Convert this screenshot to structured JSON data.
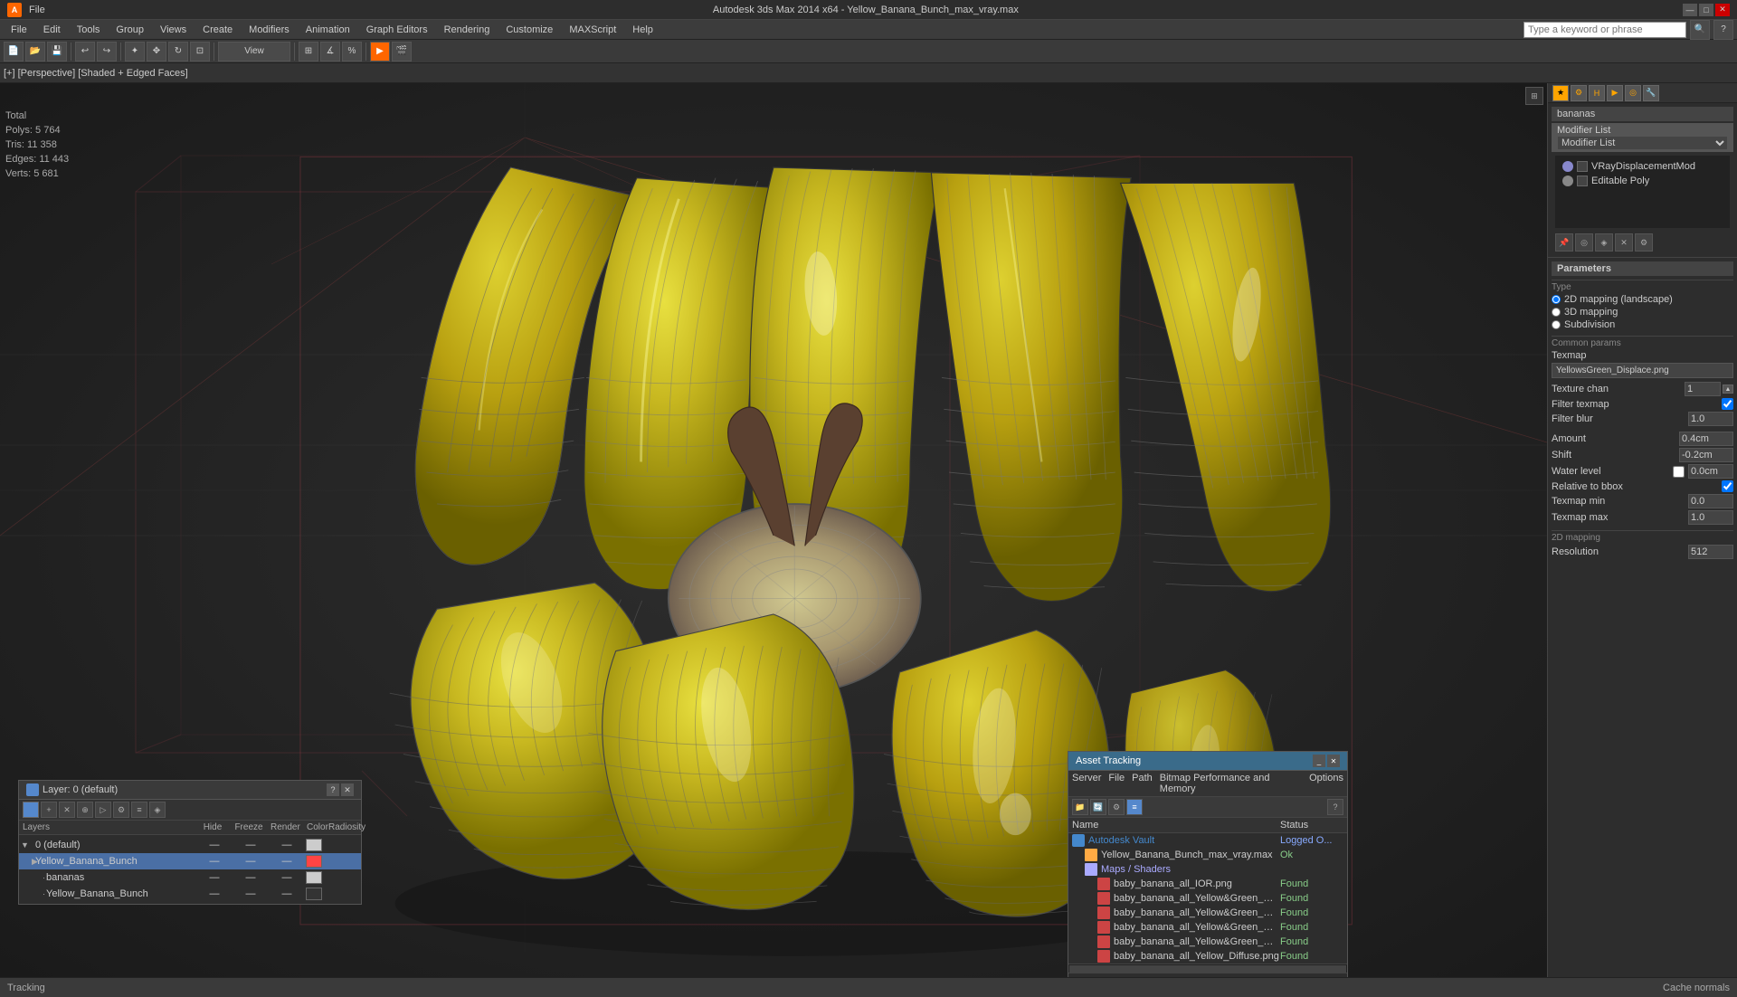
{
  "titlebar": {
    "title": "Autodesk 3ds Max 2014 x64 - Yellow_Banana_Bunch_max_vray.max",
    "minimize": "—",
    "maximize": "□",
    "close": "✕"
  },
  "menubar": {
    "items": [
      "File",
      "Edit",
      "Tools",
      "Group",
      "Views",
      "Create",
      "Modifiers",
      "Animation",
      "Graph Editors",
      "Rendering",
      "Customize",
      "MAXScript",
      "Help"
    ]
  },
  "toolbar": {
    "search_placeholder": "Type a keyword or phrase"
  },
  "viewport": {
    "label": "[+] [Perspective] [Shaded + Edged Faces]",
    "stats": {
      "polys_label": "Polys:",
      "polys_val": "5 764",
      "tris_label": "Tris:",
      "tris_val": "11 358",
      "edges_label": "Edges:",
      "edges_val": "11 443",
      "verts_label": "Verts:",
      "verts_val": "5 681"
    }
  },
  "right_panel": {
    "object_name": "bananas",
    "modifier_list_label": "Modifier List",
    "modifiers": [
      {
        "name": "VRayDisplacementMod",
        "enabled": true
      },
      {
        "name": "Editable Poly",
        "enabled": false
      }
    ],
    "params_header": "Parameters",
    "type_label": "Type",
    "type_options": [
      "2D mapping (landscape)",
      "3D mapping",
      "Subdivision"
    ],
    "type_selected": "2D mapping (landscape)",
    "common_params_label": "Common params",
    "texmap_label": "Texmap",
    "texmap_value": "YellowsGreen_Displace.png",
    "texture_chan_label": "Texture chan",
    "texture_chan_value": "1",
    "filter_texmap_label": "Filter texmap",
    "filter_texmap_checked": true,
    "filter_blur_label": "Filter blur",
    "filter_blur_value": "1.0",
    "amount_label": "Amount",
    "amount_value": "0.4cm",
    "shift_label": "Shift",
    "shift_value": "-0.2cm",
    "water_level_label": "Water level",
    "water_level_value": "0.0cm",
    "relative_bbox_label": "Relative to bbox",
    "relative_bbox_checked": true,
    "texmap_min_label": "Texmap min",
    "texmap_min_value": "0.0",
    "texmap_max_label": "Texmap max",
    "texmap_max_value": "1.0",
    "2d_mapping_label": "2D mapping",
    "resolution_label": "Resolution",
    "resolution_value": "512"
  },
  "layer_panel": {
    "title": "Layer: 0 (default)",
    "close": "✕",
    "help": "?",
    "columns": {
      "layers": "Layers",
      "hide": "Hide",
      "freeze": "Freeze",
      "render": "Render",
      "color": "Color",
      "radiosity": "Radiosity"
    },
    "rows": [
      {
        "name": "0 (default)",
        "expanded": true,
        "level": 0,
        "selected": false,
        "color": "#cccccc"
      },
      {
        "name": "Yellow_Banana_Bunch",
        "expanded": false,
        "level": 1,
        "selected": true,
        "color": "#ff4444"
      },
      {
        "name": "bananas",
        "expanded": false,
        "level": 2,
        "selected": false,
        "color": "#cccccc"
      },
      {
        "name": "Yellow_Banana_Bunch",
        "expanded": false,
        "level": 2,
        "selected": false,
        "color": "#333333"
      }
    ]
  },
  "asset_panel": {
    "title": "Asset Tracking",
    "menu": [
      "Server",
      "File",
      "Path",
      "Bitmap Performance and Memory",
      "Options"
    ],
    "columns": {
      "name": "Name",
      "status": "Status"
    },
    "rows": [
      {
        "type": "vault",
        "name": "Autodesk Vault",
        "status": "Logged O...",
        "indent": 0
      },
      {
        "type": "file",
        "name": "Yellow_Banana_Bunch_max_vray.max",
        "status": "Ok",
        "indent": 1
      },
      {
        "type": "group",
        "name": "Maps / Shaders",
        "status": "",
        "indent": 1
      },
      {
        "type": "map",
        "name": "baby_banana_all_IOR.png",
        "status": "Found",
        "indent": 2
      },
      {
        "type": "map",
        "name": "baby_banana_all_Yellow&Green_Displace.png",
        "status": "Found",
        "indent": 2
      },
      {
        "type": "map",
        "name": "baby_banana_all_Yellow&Green_Gloss.png",
        "status": "Found",
        "indent": 2
      },
      {
        "type": "map",
        "name": "baby_banana_all_Yellow&Green_Normal.png",
        "status": "Found",
        "indent": 2
      },
      {
        "type": "map",
        "name": "baby_banana_all_Yellow&Green_Reflect.png",
        "status": "Found",
        "indent": 2
      },
      {
        "type": "map",
        "name": "baby_banana_all_Yellow_Diffuse.png",
        "status": "Found",
        "indent": 2
      }
    ]
  },
  "status_bar": {
    "tracking_text": "Tracking",
    "cache_normals": "Cache normals"
  }
}
